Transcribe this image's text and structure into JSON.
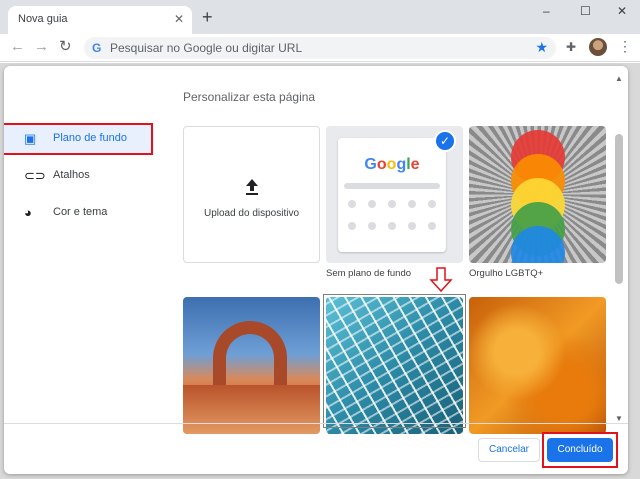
{
  "browser": {
    "tab_title": "Nova guia",
    "tab_close_glyph": "✕",
    "new_tab_glyph": "+",
    "window_controls": [
      "–",
      "☐",
      "✕"
    ],
    "omnibox_placeholder": "Pesquisar no Google ou digitar URL",
    "omnibox_google_glyph": "G",
    "back_glyph": "←",
    "forward_glyph": "→",
    "reload_glyph": "↻",
    "star_glyph": "★",
    "extensions_glyph": "✚",
    "menu_glyph": "⋮"
  },
  "dialog": {
    "title": "Personalizar esta página",
    "sidebar": [
      {
        "label": "Plano de fundo",
        "icon": "image-icon",
        "glyph": "▣",
        "selected": true
      },
      {
        "label": "Atalhos",
        "icon": "link-icon",
        "glyph": "⊂⊃",
        "selected": false
      },
      {
        "label": "Cor e tema",
        "icon": "palette-icon",
        "glyph": "◕",
        "selected": false
      }
    ],
    "tiles": {
      "upload": {
        "label": "Upload do dispositivo",
        "icon": "upload-icon"
      },
      "no_background": {
        "label": "Sem plano de fundo",
        "logo": "Google",
        "selected": true,
        "check_glyph": "✓"
      },
      "pride": {
        "label": "Orgulho LGBTQ+"
      },
      "row2": [
        "arch-landscape",
        "glass-facade",
        "amber-texture"
      ]
    },
    "buttons": {
      "cancel": "Cancelar",
      "done": "Concluído"
    },
    "scroll": {
      "up": "▲",
      "down": "▼"
    }
  },
  "colors": {
    "accent": "#1a73e8",
    "highlight": "#e0121b",
    "google_logo": [
      "#4285f4",
      "#ea4335",
      "#fbbc05",
      "#4285f4",
      "#34a853",
      "#ea4335"
    ],
    "pride": [
      "#e53935",
      "#fb8c00",
      "#fdd835",
      "#43a047",
      "#1e88e5"
    ]
  }
}
